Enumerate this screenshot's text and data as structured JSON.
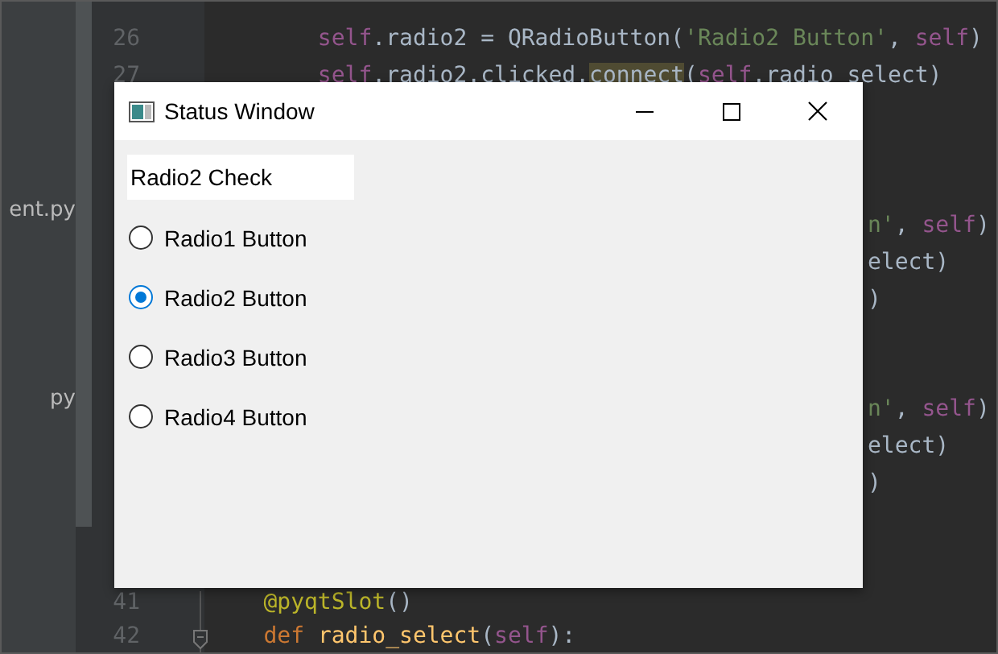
{
  "project_panel": {
    "items": [
      "ent.py",
      "py"
    ]
  },
  "editor": {
    "top_lines": [
      {
        "number": "26",
        "tokens": [
          {
            "text": "        self",
            "kind": "self"
          },
          {
            "text": ".radio2 = QRadioButton(",
            "kind": "plain"
          },
          {
            "text": "'Radio2 Button'",
            "kind": "string"
          },
          {
            "text": ", ",
            "kind": "plain"
          },
          {
            "text": "self",
            "kind": "self"
          },
          {
            "text": ")",
            "kind": "plain"
          }
        ]
      },
      {
        "number": "27",
        "tokens": [
          {
            "text": "        self",
            "kind": "self"
          },
          {
            "text": ".radio2.clicked.",
            "kind": "plain"
          },
          {
            "text": "connect",
            "kind": "highlight"
          },
          {
            "text": "(",
            "kind": "plain"
          },
          {
            "text": "self",
            "kind": "self"
          },
          {
            "text": ".radio_select)",
            "kind": "plain"
          }
        ]
      }
    ],
    "right_fragments": [
      [
        {
          "tokens": [
            {
              "text": "n'",
              "kind": "string"
            },
            {
              "text": ", ",
              "kind": "plain"
            },
            {
              "text": "self",
              "kind": "self"
            },
            {
              "text": ")",
              "kind": "plain"
            }
          ]
        },
        {
          "tokens": [
            {
              "text": "elect)",
              "kind": "plain"
            }
          ]
        },
        {
          "tokens": [
            {
              "text": ")",
              "kind": "plain"
            }
          ]
        }
      ],
      [
        {
          "tokens": [
            {
              "text": "n'",
              "kind": "string"
            },
            {
              "text": ", ",
              "kind": "plain"
            },
            {
              "text": "self",
              "kind": "self"
            },
            {
              "text": ")",
              "kind": "plain"
            }
          ]
        },
        {
          "tokens": [
            {
              "text": "elect)",
              "kind": "plain"
            }
          ]
        },
        {
          "tokens": [
            {
              "text": ")",
              "kind": "plain"
            }
          ]
        }
      ]
    ],
    "bottom_lines": [
      {
        "number": "41",
        "tokens": [
          {
            "text": "    @pyqtSlot",
            "kind": "decorator"
          },
          {
            "text": "()",
            "kind": "plain"
          }
        ]
      },
      {
        "number": "42",
        "tokens": [
          {
            "text": "    def ",
            "kind": "keyword"
          },
          {
            "text": "radio_select",
            "kind": "function"
          },
          {
            "text": "(",
            "kind": "plain"
          },
          {
            "text": "self",
            "kind": "self"
          },
          {
            "text": "):",
            "kind": "plain"
          }
        ]
      }
    ]
  },
  "window": {
    "title": "Status Window",
    "status_label": "Radio2 Check",
    "radios": [
      {
        "label": "Radio1 Button",
        "selected": false
      },
      {
        "label": "Radio2 Button",
        "selected": true
      },
      {
        "label": "Radio3 Button",
        "selected": false
      },
      {
        "label": "Radio4 Button",
        "selected": false
      }
    ]
  }
}
